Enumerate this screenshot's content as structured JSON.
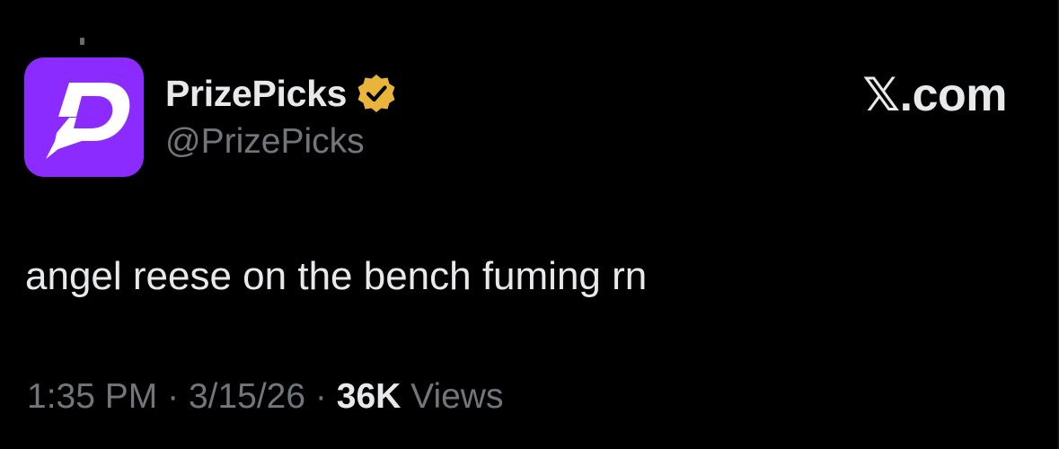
{
  "colors": {
    "background": "#000000",
    "primary_text": "#e7e9ea",
    "secondary_text": "#71767b",
    "avatar_purple": "#8b2bff",
    "verified_gold": "#e8b53a"
  },
  "post": {
    "author": {
      "display_name": "PrizePicks",
      "handle": "@PrizePicks",
      "verified": true,
      "avatar_icon": "prizepicks-logo-icon",
      "badge_icon": "verified-badge-icon"
    },
    "brand_label": "𝕏.com",
    "text": "angel reese on the bench fuming rn",
    "time": "1:35 PM",
    "date": "3/15/26",
    "separator": "·",
    "views_count": "36K",
    "views_label": "Views"
  }
}
